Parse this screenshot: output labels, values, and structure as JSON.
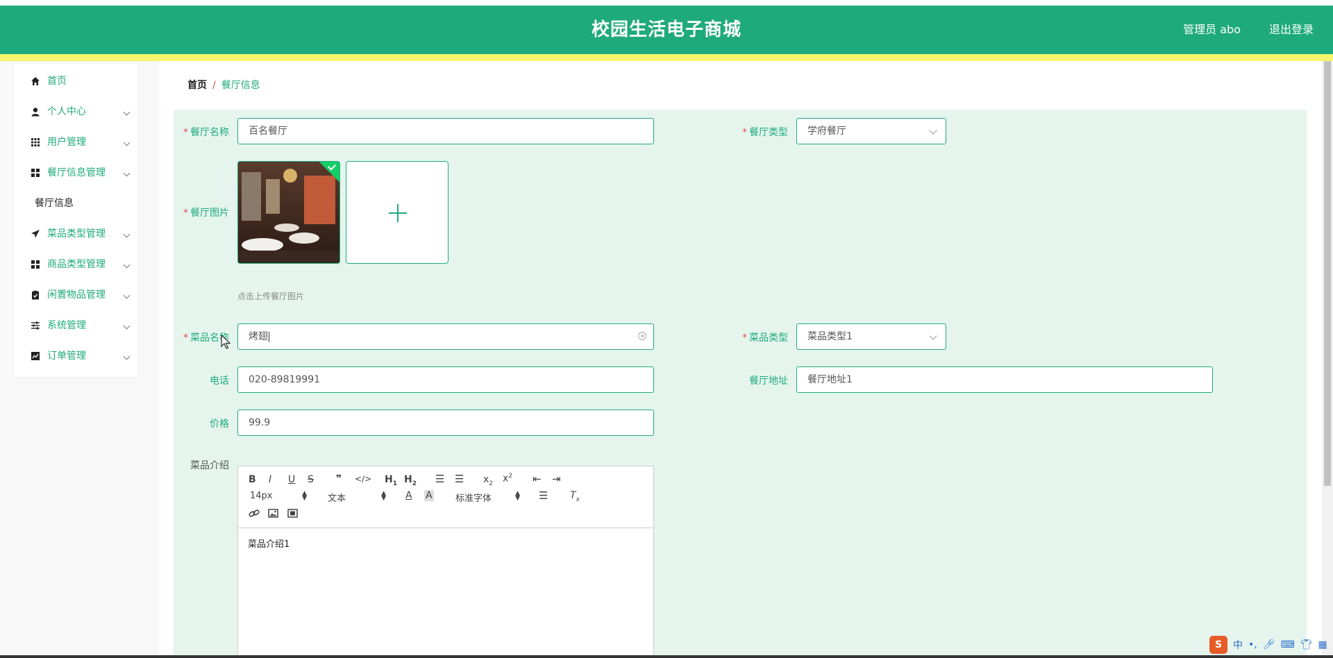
{
  "header": {
    "title": "校园生活电子商城",
    "user": "管理员 abo",
    "logout": "退出登录"
  },
  "sidebar": {
    "items": [
      {
        "label": "首页",
        "icon": "home-icon",
        "expandable": false
      },
      {
        "label": "个人中心",
        "icon": "user-icon",
        "expandable": true
      },
      {
        "label": "用户管理",
        "icon": "grid-icon",
        "expandable": true
      },
      {
        "label": "餐厅信息管理",
        "icon": "apps-icon",
        "expandable": true
      },
      {
        "label": "餐厅信息",
        "icon": "",
        "expandable": false,
        "submenu": true
      },
      {
        "label": "菜品类型管理",
        "icon": "send-icon",
        "expandable": true
      },
      {
        "label": "商品类型管理",
        "icon": "apps-icon",
        "expandable": true
      },
      {
        "label": "闲置物品管理",
        "icon": "clipboard-icon",
        "expandable": true
      },
      {
        "label": "系统管理",
        "icon": "sliders-icon",
        "expandable": true
      },
      {
        "label": "订单管理",
        "icon": "chart-icon",
        "expandable": true
      }
    ]
  },
  "breadcrumb": {
    "home": "首页",
    "separator": "/",
    "current": "餐厅信息"
  },
  "form": {
    "restaurant_name": {
      "label": "餐厅名称",
      "value": "百名餐厅"
    },
    "restaurant_type": {
      "label": "餐厅类型",
      "value": "学府餐厅"
    },
    "restaurant_image": {
      "label": "餐厅图片",
      "hint": "点击上传餐厅图片"
    },
    "dish_name": {
      "label": "菜品名称",
      "value": "烤翅"
    },
    "dish_type": {
      "label": "菜品类型",
      "value": "菜品类型1"
    },
    "phone": {
      "label": "电话",
      "value": "020-89819991"
    },
    "address": {
      "label": "餐厅地址",
      "value": "餐厅地址1"
    },
    "price": {
      "label": "价格",
      "value": "99.9"
    },
    "intro": {
      "label": "菜品介绍",
      "content": "菜品介绍1",
      "font_size": "14px",
      "paragraph": "文本",
      "font_family": "标准字体"
    }
  },
  "ime": {
    "lang": "中",
    "punct": "•,"
  }
}
